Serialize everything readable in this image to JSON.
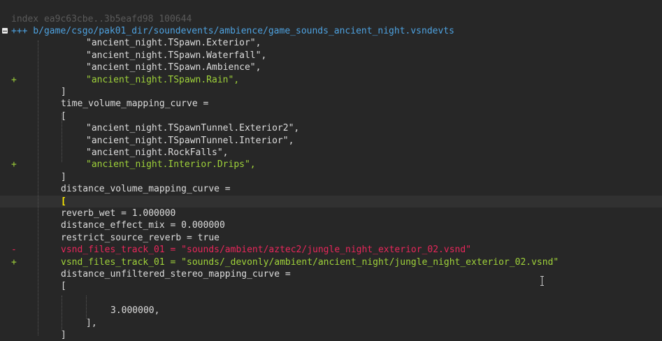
{
  "colors": {
    "background": "#272727",
    "current_line": "#313131",
    "header": "#5a5a5a",
    "file_header": "#4ea2e0",
    "context": "#dcdcdc",
    "added": "#9fd23a",
    "removed": "#e8275a",
    "bracket_highlight": "#ffee00"
  },
  "diff": {
    "lines": [
      {
        "marker": "",
        "text": "index ea9c63cbe..3b5eafd98 100644",
        "type": "header"
      },
      {
        "marker": "+++",
        "text": " b/game/csgo/pak01_dir/soundevents/ambience/game_sounds_ancient_night.vsndevts",
        "type": "file"
      },
      {
        "marker": "",
        "text": "\"ancient_night.TSpawn.Exterior\",",
        "type": "context"
      },
      {
        "marker": "",
        "text": "\"ancient_night.TSpawn.Waterfall\",",
        "type": "context"
      },
      {
        "marker": "",
        "text": "\"ancient_night.TSpawn.Ambience\",",
        "type": "context"
      },
      {
        "marker": "+",
        "text": "\"ancient_night.TSpawn.Rain\",",
        "type": "added"
      },
      {
        "marker": "",
        "text": "]",
        "type": "context"
      },
      {
        "marker": "",
        "text": "time_volume_mapping_curve =",
        "type": "context"
      },
      {
        "marker": "",
        "text": "[",
        "type": "context"
      },
      {
        "marker": "",
        "text": "\"ancient_night.TSpawnTunnel.Exterior2\",",
        "type": "context"
      },
      {
        "marker": "",
        "text": "\"ancient_night.TSpawnTunnel.Interior\",",
        "type": "context"
      },
      {
        "marker": "",
        "text": "\"ancient_night.RockFalls\",",
        "type": "context"
      },
      {
        "marker": "+",
        "text": "\"ancient_night.Interior.Drips\",",
        "type": "added"
      },
      {
        "marker": "",
        "text": "]",
        "type": "context"
      },
      {
        "marker": "",
        "text": "distance_volume_mapping_curve =",
        "type": "context"
      },
      {
        "marker": "",
        "text": "[",
        "type": "bracket"
      },
      {
        "marker": "",
        "text": "reverb_wet = 1.000000",
        "type": "context"
      },
      {
        "marker": "",
        "text": "distance_effect_mix = 0.000000",
        "type": "context"
      },
      {
        "marker": "",
        "text": "restrict_source_reverb = true",
        "type": "context"
      },
      {
        "marker": "-",
        "text": "vsnd_files_track_01 = \"sounds/ambient/aztec2/jungle_night_exterior_02.vsnd\"",
        "type": "removed"
      },
      {
        "marker": "+",
        "text": "vsnd_files_track_01 = \"sounds/_devonly/ambient/ancient_night/jungle_night_exterior_02.vsnd\"",
        "type": "added"
      },
      {
        "marker": "",
        "text": "distance_unfiltered_stereo_mapping_curve =",
        "type": "context"
      },
      {
        "marker": "",
        "text": "[",
        "type": "context"
      },
      {
        "marker": "",
        "text": "",
        "type": "context"
      },
      {
        "marker": "",
        "text": "3.000000,",
        "type": "context"
      },
      {
        "marker": "",
        "text": "],",
        "type": "context"
      },
      {
        "marker": "",
        "text": "]",
        "type": "context"
      }
    ]
  }
}
